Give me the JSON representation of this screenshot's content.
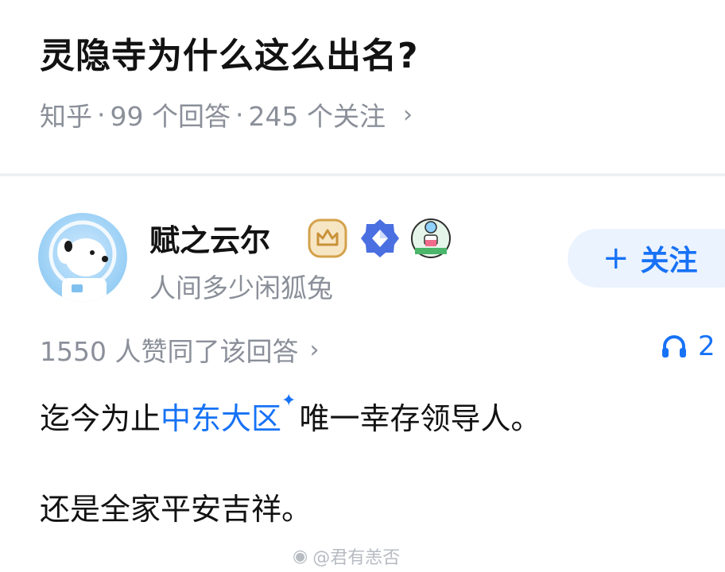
{
  "question": {
    "title": "灵隐寺为什么这么出名?",
    "source": "知乎",
    "separator": "·",
    "answers_count": "99 个回答",
    "followers_count": "245 个关注"
  },
  "author": {
    "name": "赋之云尔",
    "bio": "人间多少闲狐兔",
    "follow_label": "关注",
    "follow_icon": "+"
  },
  "answer": {
    "votes_text": "1550 人赞同了该回答",
    "listen_count": "2",
    "para1_before": "迄今为止",
    "para1_link": "中东大区",
    "para1_after": "唯一幸存领导人。",
    "para2": "还是全家平安吉祥。"
  },
  "watermark": {
    "text": "@君有恙否"
  },
  "icons": {
    "chevron": "chevron-right-icon",
    "headphones": "headphones-icon",
    "spark": "spark-icon"
  },
  "colors": {
    "accent": "#1772f6",
    "meta": "#8a8f99",
    "follow_bg": "#ebf3ff"
  }
}
